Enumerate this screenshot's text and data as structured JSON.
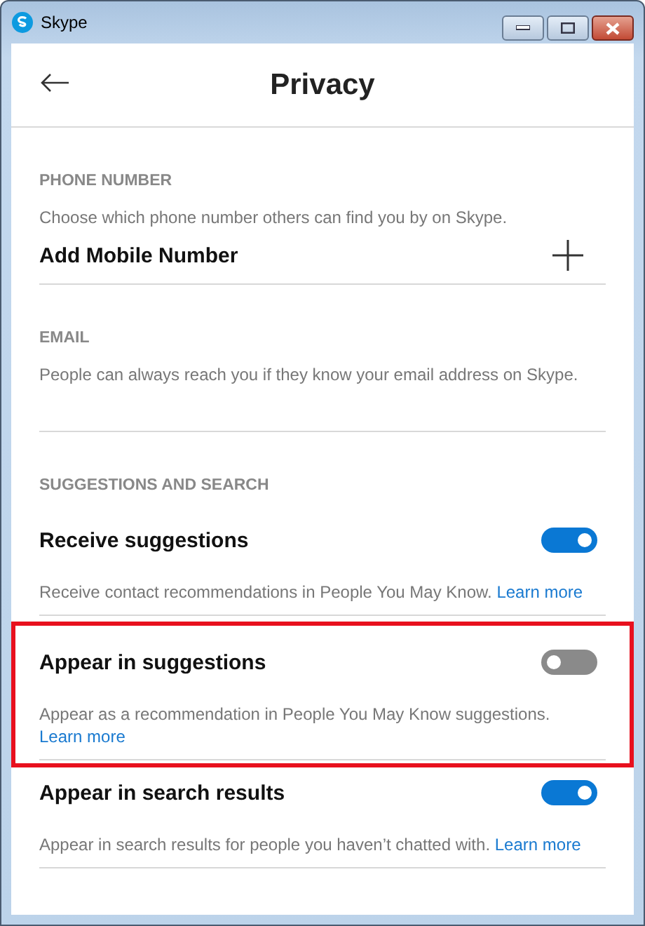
{
  "window": {
    "title": "Skype"
  },
  "header": {
    "title": "Privacy"
  },
  "phone": {
    "heading": "PHONE NUMBER",
    "description": "Choose which phone number others can find you by on Skype.",
    "action": "Add Mobile Number"
  },
  "email": {
    "heading": "EMAIL",
    "description": "People can always reach you if they know your email address on Skype."
  },
  "suggestions": {
    "heading": "SUGGESTIONS AND SEARCH",
    "items": [
      {
        "label": "Receive suggestions",
        "on": true,
        "description": "Receive contact recommendations in People You May Know.",
        "link": "Learn more",
        "highlighted": false
      },
      {
        "label": "Appear in suggestions",
        "on": false,
        "description": "Appear as a recommendation in People You May Know suggestions.",
        "link": "Learn more",
        "highlighted": true
      },
      {
        "label": "Appear in search results",
        "on": true,
        "description": "Appear in search results for people you haven’t chatted with.",
        "link": "Learn more",
        "highlighted": false
      }
    ]
  }
}
